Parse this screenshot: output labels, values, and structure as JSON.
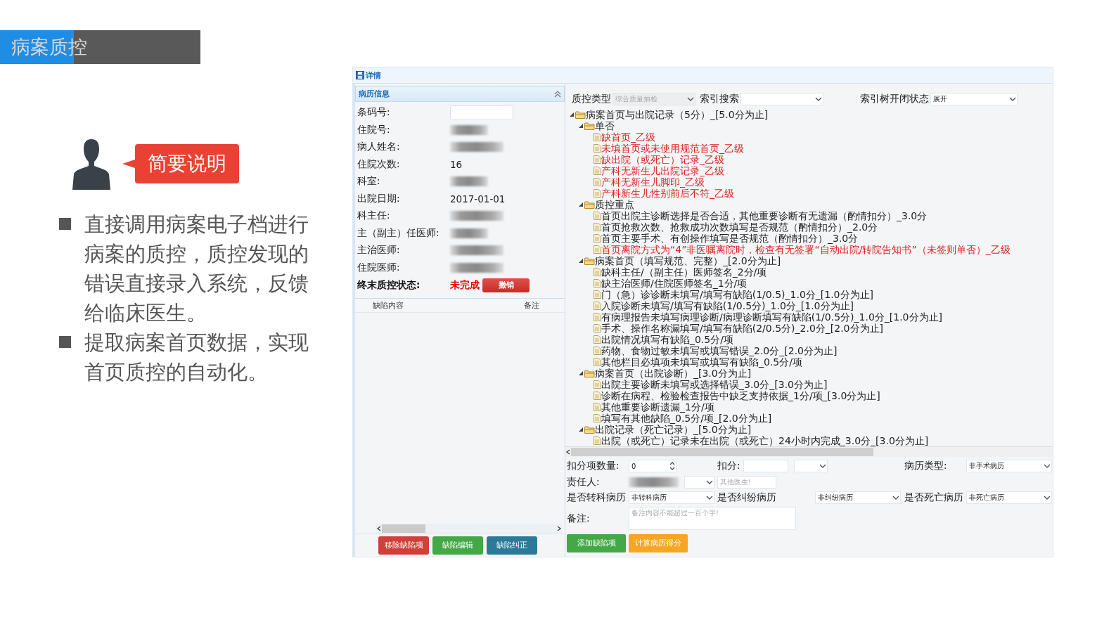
{
  "slide": {
    "title": "病案质控",
    "callout": "简要说明",
    "bullets": [
      "直接调用病案电子档进行病案的质控，质控发现的错误直接录入系统，反馈给临床医生。",
      "提取病案首页数据，实现首页质控的自动化。"
    ]
  },
  "app": {
    "title": "详情",
    "record_panel": {
      "title": "病历信息",
      "fields": [
        {
          "label": "条码号:",
          "kind": "input"
        },
        {
          "label": "住院号:",
          "kind": "blurred"
        },
        {
          "label": "病人姓名:",
          "kind": "blurred"
        },
        {
          "label": "住院次数:",
          "kind": "text",
          "value": "16"
        },
        {
          "label": "科室:",
          "kind": "blurred"
        },
        {
          "label": "出院日期:",
          "kind": "text",
          "value": "2017-01-01"
        },
        {
          "label": "科主任:",
          "kind": "blurred"
        },
        {
          "label": "主（副主）任医师:",
          "kind": "blurred"
        },
        {
          "label": "主治医师:",
          "kind": "blurred"
        },
        {
          "label": "住院医师:",
          "kind": "blurred"
        }
      ],
      "status": {
        "label": "终末质控状态:",
        "value": "未完成",
        "button": "撤销"
      }
    },
    "defect_table": {
      "columns": [
        "缺陷内容",
        "备注"
      ]
    },
    "left_buttons": [
      {
        "label": "移除缺陷项",
        "color": "#d23f3b"
      },
      {
        "label": "缺陷编辑",
        "color": "#45a847"
      },
      {
        "label": "缺陷纠正",
        "color": "#2b7a98"
      }
    ],
    "tree_toolbar": [
      {
        "label": "质控类型",
        "value": "综合质量抽检",
        "disabled": true
      },
      {
        "label": "索引搜索",
        "disabled": false
      },
      {
        "label": "索引树开闭状态",
        "value": "展开",
        "disabled": false
      }
    ],
    "tree": [
      {
        "label": "病案首页与出院记录（5分）_[5.0分为止]",
        "expanded": true,
        "children": [
          {
            "label": "单否",
            "expanded": true,
            "children": [
              {
                "label": "缺首页_乙级",
                "color": "#e02020"
              },
              {
                "label": "未填首页或未使用规范首页_乙级",
                "color": "#e02020"
              },
              {
                "label": "缺出院（或死亡）记录_乙级",
                "color": "#e02020"
              },
              {
                "label": "产科无新生儿出院记录_乙级",
                "color": "#e02020"
              },
              {
                "label": "产科无新生儿脚印_乙级",
                "color": "#e02020"
              },
              {
                "label": "产科新生儿性别前后不符_乙级",
                "color": "#e02020"
              }
            ]
          },
          {
            "label": "质控重点",
            "expanded": true,
            "children": [
              {
                "label": "首页出院主诊断选择是否合适，其他重要诊断有无遗漏（酌情扣分）_3.0分",
                "color": "#222222"
              },
              {
                "label": "首页抢救次数、抢救成功次数填写是否规范（酌情扣分）_2.0分",
                "color": "#222222"
              },
              {
                "label": "首页主要手术、有创操作填写是否规范（酌情扣分）_3.0分",
                "color": "#222222"
              },
              {
                "label": "首页离院方式为“4”非医嘱离院时，检查有无签署“自动出院/转院告知书”（未签则单否）_乙级",
                "color": "#e02020"
              }
            ]
          },
          {
            "label": "病案首页（填写规范、完整）_[2.0分为止]",
            "expanded": true,
            "children": [
              {
                "label": "缺科主任/（副主任）医师签名_2分/项",
                "color": "#222222"
              },
              {
                "label": "缺主治医师/住院医师签名_1分/项",
                "color": "#222222"
              },
              {
                "label": "门（急）诊诊断未填写/填写有缺陷(1/0.5)_1.0分_[1.0分为止]",
                "color": "#222222"
              },
              {
                "label": "入院诊断未填写/填写有缺陷(1/0.5分)_1.0分_[1.0分为止]",
                "color": "#222222"
              },
              {
                "label": "有病理报告未填写病理诊断/病理诊断填写有缺陷(1/0.5分)_1.0分_[1.0分为止]",
                "color": "#222222"
              },
              {
                "label": "手术、操作名称漏填写/填写有缺陷(2/0.5分)_2.0分_[2.0分为止]",
                "color": "#222222"
              },
              {
                "label": "出院情况填写有缺陷_0.5分/项",
                "color": "#222222"
              },
              {
                "label": "药物、食物过敏未填写或填写错误_2.0分_[2.0分为止]",
                "color": "#222222"
              },
              {
                "label": "其他栏目必填项未填写或填写有缺陷_0.5分/项",
                "color": "#222222"
              }
            ]
          },
          {
            "label": "病案首页（出院诊断）_[3.0分为止]",
            "expanded": true,
            "children": [
              {
                "label": "出院主要诊断未填写或选择错误_3.0分_[3.0分为止]",
                "color": "#222222"
              },
              {
                "label": "诊断在病程、检验检查报告中缺乏支持依据_1分/项_[3.0分为止]",
                "color": "#222222"
              },
              {
                "label": "其他重要诊断遗漏_1分/项",
                "color": "#222222"
              },
              {
                "label": "填写有其他缺陷_0.5分/项_[2.0分为止]",
                "color": "#222222"
              }
            ]
          },
          {
            "label": "出院记录（死亡记录）_[5.0分为止]",
            "expanded": true,
            "children": [
              {
                "label": "出院（或死亡）记录未在出院（或死亡）24小时内完成_3.0分_[3.0分为止]",
                "color": "#222222"
              }
            ]
          }
        ]
      }
    ],
    "defect_form": [
      [
        {
          "label": "扣分项数量:",
          "control": {
            "kind": "spinner",
            "value": "0"
          }
        },
        {
          "label": "扣分:",
          "control": {
            "kind": "input-select"
          }
        },
        {
          "label": "病历类型:",
          "control": {
            "kind": "select",
            "value": "非手术病历"
          }
        }
      ],
      [
        {
          "label": "责任人:",
          "control": {
            "kind": "blurred-select"
          }
        },
        {
          "control": {
            "kind": "input",
            "placeholder": "其他医生!"
          }
        }
      ],
      [
        {
          "label": "是否转科病历",
          "control": {
            "kind": "select",
            "value": "非转科病历"
          }
        },
        {
          "label": "是否纠纷病历",
          "control": {
            "kind": "select",
            "value": "非纠纷病历"
          }
        },
        {
          "label": "是否死亡病历",
          "control": {
            "kind": "select",
            "value": "非死亡病历"
          }
        }
      ],
      [
        {
          "label": "备注:",
          "control": {
            "kind": "textarea",
            "placeholder": "备注内容不能超过一百个字!"
          }
        }
      ]
    ],
    "form_buttons": [
      {
        "label": "添加缺陷项",
        "color": "#45a847"
      },
      {
        "label": "计算病历得分",
        "color": "#f5a623"
      }
    ]
  }
}
